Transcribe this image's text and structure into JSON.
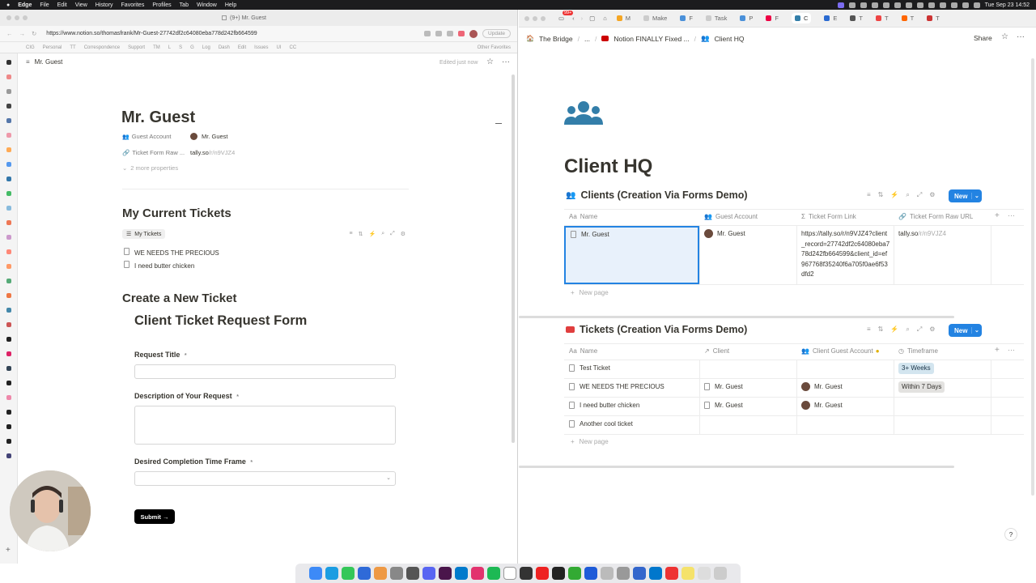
{
  "menubar": {
    "app": "Edge",
    "items": [
      "File",
      "Edit",
      "View",
      "History",
      "Favorites",
      "Profiles",
      "Tab",
      "Window",
      "Help"
    ],
    "datetime": "Tue Sep 23  14:52"
  },
  "left_browser": {
    "tab_title": "(9+) Mr. Guest",
    "url": "https://www.notion.so/thomasfrank/Mr-Guest-27742df2c64080eba778d242fb664599",
    "update_label": "Update",
    "bookmarks": [
      "CIG",
      "Personal",
      "TT",
      "Correspondence",
      "Support",
      "TM",
      "L",
      "S",
      "G",
      "Log",
      "Dash",
      "Edit",
      "Issues",
      "UI",
      "CC"
    ],
    "other_favorites": "Other Favorites",
    "page": {
      "breadcrumb": "Mr. Guest",
      "edited": "Edited just now",
      "title": "Mr. Guest",
      "props": [
        {
          "name": "Guest Account",
          "value": "Mr. Guest"
        },
        {
          "name": "Ticket Form Raw ...",
          "value": "tally.so",
          "value_muted": "/r/n9VJZ4"
        }
      ],
      "more_props": "2 more properties",
      "tickets_heading": "My Current Tickets",
      "view_label": "My Tickets",
      "tickets": [
        "WE NEEDS THE PRECIOUS",
        "I need butter chicken"
      ],
      "create_heading": "Create a New Ticket",
      "form": {
        "title": "Client Ticket Request Form",
        "request_title_label": "Request Title",
        "description_label": "Description of Your Request",
        "timeframe_label": "Desired Completion Time Frame",
        "required_mark": "*",
        "submit_label": "Submit →"
      }
    }
  },
  "right_browser": {
    "breadcrumb": [
      "The Bridge",
      "...",
      "Notion FINALLY Fixed ...",
      "Client HQ"
    ],
    "share_label": "Share",
    "tabs": [
      "M",
      "Make",
      "F",
      "Task",
      "P",
      "F",
      "C",
      "E",
      "T",
      "T",
      "T",
      "T"
    ],
    "tab_badge": "99+",
    "page_title": "Client HQ",
    "clients_db": {
      "title": "Clients (Creation Via Forms Demo)",
      "new_label": "New",
      "columns": [
        "Name",
        "Guest Account",
        "Ticket Form Link",
        "Ticket Form Raw URL"
      ],
      "rows": [
        {
          "name": "Mr. Guest",
          "guest_account": "Mr. Guest",
          "ticket_form_link": "https://tally.so/r/n9VJZ4?client_record=27742df2c64080eba778d242fb664599&client_id=ef967768f35240f6a705f0ae6f53dfd2",
          "raw_url": "tally.so",
          "raw_url_muted": "/r/n9VJZ4"
        }
      ],
      "new_page": "New page"
    },
    "tickets_db": {
      "title": "Tickets (Creation Via Forms Demo)",
      "new_label": "New",
      "columns": [
        "Name",
        "Client",
        "Client Guest Account",
        "Timeframe"
      ],
      "rows": [
        {
          "name": "Test Ticket",
          "client": "",
          "guest": "",
          "timeframe": "3+ Weeks"
        },
        {
          "name": "WE NEEDS THE PRECIOUS",
          "client": "Mr. Guest",
          "guest": "Mr. Guest",
          "timeframe": "Within 7 Days"
        },
        {
          "name": "I need butter chicken",
          "client": "Mr. Guest",
          "guest": "Mr. Guest",
          "timeframe": ""
        },
        {
          "name": "Another cool ticket",
          "client": "",
          "guest": "",
          "timeframe": ""
        }
      ],
      "new_page": "New page"
    }
  },
  "colors": {
    "accent": "#2383e2",
    "clients_icon": "#e03e3e",
    "people_icon": "#337ea9",
    "tag_blue": "#d3e5ef",
    "tag_gray": "#e3e2e0"
  }
}
